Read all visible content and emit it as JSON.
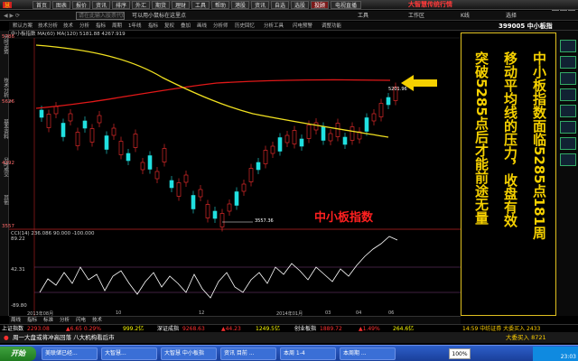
{
  "menubar": {
    "items": [
      "首页",
      "图表",
      "报价",
      "资讯",
      "排序",
      "外汇",
      "期货",
      "理财",
      "工具",
      "帮助",
      "港股",
      "资讯",
      "自选",
      "选股",
      "投顾",
      "电视直播"
    ],
    "active_index": 14,
    "app_title": "大智慧传统行情"
  },
  "toolbar2": {
    "search_placeholder": "请在此输入股票代码拼音",
    "items": [
      "可以用小鼠标在这里点",
      "工具",
      "工作区",
      "K线",
      "选择"
    ]
  },
  "tabs": {
    "items": [
      "默认方案",
      "技术分析",
      "技术",
      "分析",
      "指标",
      "周期",
      "1年线",
      "指标",
      "复权",
      "叠加",
      "画线",
      "分析师",
      "历史回忆",
      "分析工具",
      "闪电预警",
      "调整功能"
    ],
    "stock_code": "399005 中小板指"
  },
  "left_strip": [
    "分时走势",
    "技术分析",
    "基本资料",
    "分时成交",
    "其他"
  ],
  "chart": {
    "header_ma": "中小板指数  MA(60)  MA(120) 5181.88  4267.919",
    "y_labels": [
      "5786",
      "5626",
      "4292",
      "3557"
    ],
    "high_label": "5201.96",
    "low_label": "3557.36",
    "watermark": "中小板指数",
    "x_labels": [
      "2013年08月",
      "10",
      "12",
      "2014年01月",
      "03",
      "04",
      "06"
    ],
    "osc_header": "CCI(14) 236.086  90.000  -100.000",
    "osc_labels": [
      "89.22",
      "42.31",
      "-89.80"
    ]
  },
  "chart_data": {
    "type": "candlestick",
    "title": "中小板指数",
    "y_ticks": [
      5786,
      5626,
      4292,
      3557
    ],
    "high": 5201.96,
    "low": 3557.36,
    "series": [
      {
        "name": "MA(60)",
        "type": "line"
      },
      {
        "name": "MA(120)",
        "type": "line"
      },
      {
        "name": "CCI(14)",
        "type": "line",
        "last": 236.086
      }
    ]
  },
  "annotation": {
    "lines": [
      "中小板指数面临5285点181周",
      "移动平均线的压力，收盘有效",
      "突破5285点后才能前途无量"
    ]
  },
  "bottom_tabs": [
    "周线",
    "指标",
    "标准",
    "分析",
    "闪电",
    "技术"
  ],
  "ticker": {
    "items": [
      {
        "text": "上证指数",
        "color": "#ffffff"
      },
      {
        "text": "2293.08",
        "color": "#ff3030"
      },
      {
        "text": "▲6.65 0.29%",
        "color": "#ff3030"
      },
      {
        "text": "999.2亿",
        "color": "#ffff00"
      },
      {
        "text": "深证成指",
        "color": "#ffffff"
      },
      {
        "text": "9268.63",
        "color": "#ff3030"
      },
      {
        "text": "▲44.23",
        "color": "#ff3030"
      },
      {
        "text": "1249.5亿",
        "color": "#ffff00"
      },
      {
        "text": "创业板指",
        "color": "#ffffff"
      },
      {
        "text": "1889.72",
        "color": "#ff3030"
      },
      {
        "text": "▲1.49%",
        "color": "#ff3030"
      },
      {
        "text": "264.6亿",
        "color": "#ffff00"
      }
    ],
    "right": "14:59  中纺证券 大委买入 2433"
  },
  "news": {
    "text": "周一大盘或将冲高回落  八大机构看后市",
    "right": "大委买入 8721"
  },
  "taskbar": {
    "start_label": "开始",
    "items": [
      "美联储已经...",
      "大智慧...",
      "大智慧 中小板指",
      "资讯 目前 ...",
      "本周 1-4",
      "本周期 ..."
    ],
    "zoom": "100%",
    "time": "23:03"
  }
}
